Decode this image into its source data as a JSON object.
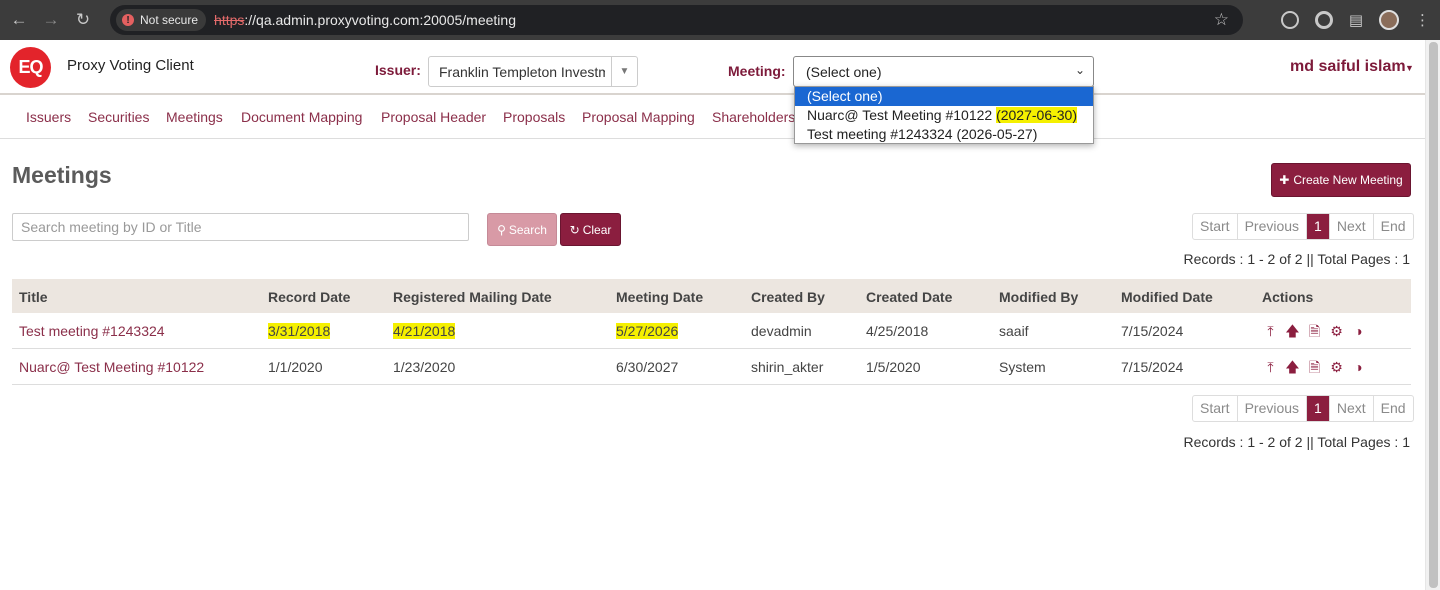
{
  "browser": {
    "security_label": "Not secure",
    "url_scheme": "https",
    "url_rest": "://qa.admin.proxyvoting.com:20005/meeting"
  },
  "header": {
    "logo_text": "EQ",
    "app_title": "Proxy Voting Client",
    "issuer_label": "Issuer:",
    "issuer_value": "Franklin Templeton Investments",
    "meeting_label": "Meeting:",
    "meeting_value": "(Select one)",
    "user_name": "md saiful islam"
  },
  "nav": {
    "items": [
      "Issuers",
      "Securities",
      "Meetings",
      "Document Mapping",
      "Proposal Header",
      "Proposals",
      "Proposal Mapping",
      "Shareholders"
    ]
  },
  "meeting_dropdown": {
    "options": [
      {
        "label": "(Select one)",
        "date": ""
      },
      {
        "label": "Nuarc@ Test Meeting #10122 ",
        "date": "(2027-06-30)"
      },
      {
        "label": "Test meeting #1243324 (2026-05-27)",
        "date": ""
      }
    ],
    "selected_index": 0,
    "highlight_color": "#f5f000"
  },
  "page": {
    "title": "Meetings",
    "create_button": "Create New Meeting",
    "search_placeholder": "Search meeting by ID or Title",
    "search_button": "Search",
    "clear_button": "Clear"
  },
  "pagination": {
    "start": "Start",
    "previous": "Previous",
    "current": "1",
    "next": "Next",
    "end": "End",
    "records_text": "Records : 1 - 2 of 2 || Total Pages : 1"
  },
  "table": {
    "headers": [
      "Title",
      "Record Date",
      "Registered Mailing Date",
      "Meeting Date",
      "Created By",
      "Created Date",
      "Modified By",
      "Modified Date",
      "Actions"
    ],
    "rows": [
      {
        "title": "Test meeting #1243324",
        "record_date": "3/31/2018",
        "mailing_date": "4/21/2018",
        "meeting_date": "5/27/2026",
        "created_by": "devadmin",
        "created_date": "4/25/2018",
        "modified_by": "saaif",
        "modified_date": "7/15/2024"
      },
      {
        "title": "Nuarc@ Test Meeting #10122",
        "record_date": "1/1/2020",
        "mailing_date": "1/23/2020",
        "meeting_date": "6/30/2027",
        "created_by": "shirin_akter",
        "created_date": "1/5/2020",
        "modified_by": "System",
        "modified_date": "7/15/2024"
      }
    ],
    "action_icons": [
      "upload-icon",
      "arrow-up-icon",
      "document-icon",
      "gear-icon",
      "half-circle-icon"
    ]
  },
  "colors": {
    "brand": "#8b1e3f",
    "logo_red": "#e3242b",
    "table_header_bg": "#ece6e0",
    "dropdown_selected": "#1a67d2"
  }
}
